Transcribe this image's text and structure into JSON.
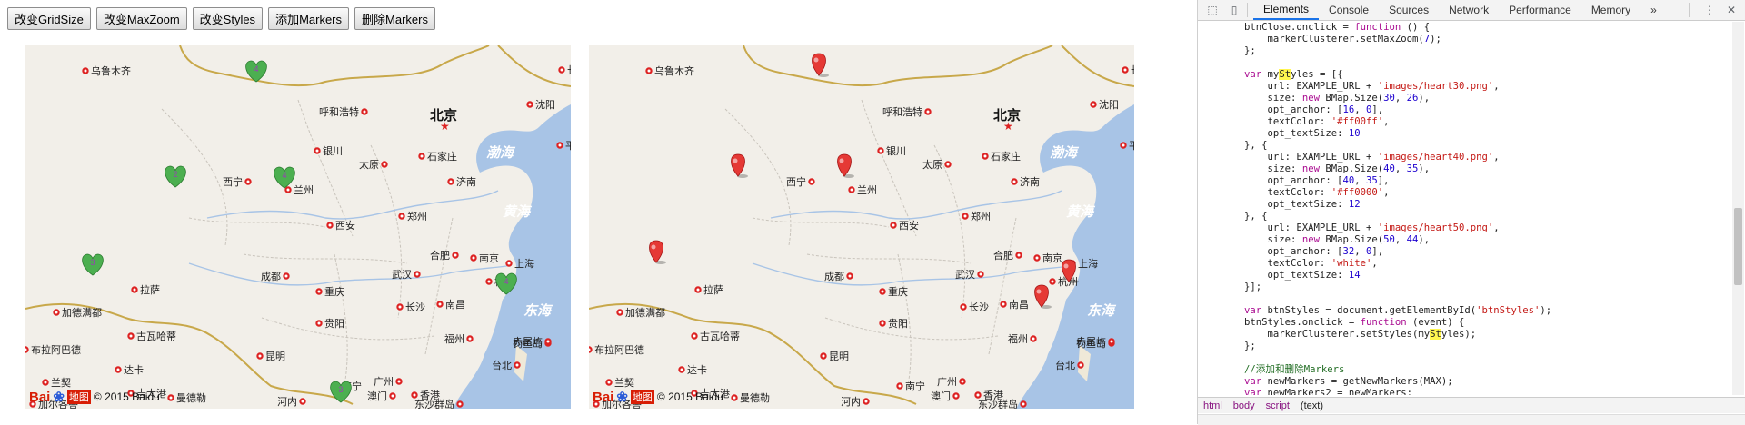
{
  "toolbar": {
    "buttons": [
      "改变GridSize",
      "改变MaxZoom",
      "改变Styles",
      "添加Markers",
      "删除Markers"
    ]
  },
  "map": {
    "cities": [
      "乌鲁木齐",
      "呼和浩特",
      "北京",
      "沈阳",
      "银川",
      "石家庄",
      "太原",
      "西宁",
      "兰州",
      "济南",
      "西安",
      "郑州",
      "合肥",
      "南京",
      "上海",
      "杭州",
      "成都",
      "重庆",
      "武汉",
      "拉萨",
      "长沙",
      "南昌",
      "贵阳",
      "福州",
      "昆明",
      "南宁",
      "广州",
      "台北",
      "香港",
      "澳门",
      "加德满都",
      "吉大港",
      "加尔各答",
      "长春",
      "平壤",
      "达卡",
      "曼德勒",
      "河内",
      "钓鱼岛",
      "赤尾屿",
      "兰契",
      "东沙群岛",
      "古瓦哈蒂",
      "布拉阿巴德"
    ],
    "seas": [
      "渤海",
      "黄海",
      "东海"
    ],
    "copyright": "© 2015 Baidu",
    "logo_bai": "Bai",
    "logo_ditu": "地图",
    "heart_color": "#4caf50",
    "marker_color": "#e53935"
  },
  "devtools": {
    "tabs": [
      "Elements",
      "Console",
      "Sources",
      "Network",
      "Performance",
      "Memory"
    ],
    "active_tab": "Elements",
    "more": "»",
    "breadcrumbs": [
      "html",
      "body",
      "script",
      "(text)"
    ],
    "code_lines": [
      "        btnClose.onclick = function () {",
      "            markerClusterer.setMaxZoom(7);",
      "        };",
      "",
      "        var myStyles = [{",
      "            url: EXAMPLE_URL + 'images/heart30.png',",
      "            size: new BMap.Size(30, 26),",
      "            opt_anchor: [16, 0],",
      "            textColor: '#ff00ff',",
      "            opt_textSize: 10",
      "        }, {",
      "            url: EXAMPLE_URL + 'images/heart40.png',",
      "            size: new BMap.Size(40, 35),",
      "            opt_anchor: [40, 35],",
      "            textColor: '#ff0000',",
      "            opt_textSize: 12",
      "        }, {",
      "            url: EXAMPLE_URL + 'images/heart50.png',",
      "            size: new BMap.Size(50, 44),",
      "            opt_anchor: [32, 0],",
      "            textColor: 'white',",
      "            opt_textSize: 14",
      "        }];",
      "",
      "        var btnStyles = document.getElementById('btnStyles');",
      "        btnStyles.onclick = function (event) {",
      "            markerClusterer.setStyles(myStyles);",
      "        };",
      "",
      "        //添加和删除Markers",
      "        var newMarkers = getNewMarkers(MAX);",
      "        var newMarkers2 = newMarkers;"
    ]
  }
}
